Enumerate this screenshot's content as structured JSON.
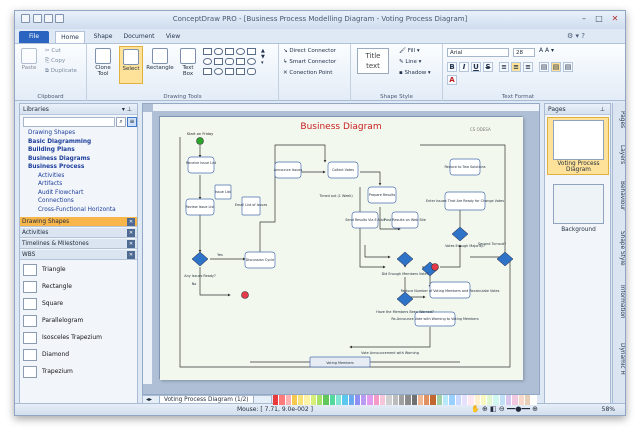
{
  "window": {
    "title": "ConceptDraw PRO - [Business Process Modelling Diagram - Voting Process Diagram]"
  },
  "tabs": [
    "File",
    "Home",
    "Shape",
    "Document",
    "View"
  ],
  "clipboard": {
    "paste": "Paste",
    "cut": "Cut",
    "copy": "Copy",
    "duplicate": "Duplicate",
    "label": "Clipboard"
  },
  "drawing": {
    "clone": "Clone Tool",
    "select": "Select",
    "rectangle": "Rectangle",
    "textbox": "Text Box",
    "direct": "Direct Connector",
    "smart": "Smart Connector",
    "point": "Conection Point",
    "label": "Drawing Tools"
  },
  "shapestyle": {
    "sample": "Title text",
    "fill": "Fill",
    "line": "Line",
    "shadow": "Shadow",
    "label": "Shape Style"
  },
  "textformat": {
    "font": "Arial",
    "size": "28",
    "label": "Text Format",
    "bold": "B",
    "italic": "I",
    "underline": "U",
    "strike": "S"
  },
  "libraries": {
    "header": "Libraries",
    "tree": [
      "Drawing Shapes",
      "Basic Diagramming",
      "Building Plans",
      "Business Diagrams",
      "Business Process",
      "Activities",
      "Artifacts",
      "Audit Flowchart",
      "Connections",
      "Cross-Functional Horizonta"
    ],
    "sections": [
      "Drawing Shapes",
      "Activities",
      "Timelines & Milestones",
      "WBS"
    ],
    "shapes": [
      "Triangle",
      "Rectangle",
      "Square",
      "Parallelogram",
      "Isosceles Trapezium",
      "Diamond",
      "Trapezium"
    ]
  },
  "diagram": {
    "title": "Business Diagram",
    "logo": "CS ODESA",
    "nodes": [
      "Start on Friday",
      "Receive Issue List",
      "Issue List",
      "Email List of Issues",
      "Review Issue List",
      "Any Issues Ready?",
      "Discussion Cycle",
      "Announce Issues",
      "Collect Votes",
      "Timed out (1 Week)",
      "Prepare Results",
      "Send Results Via E-Mail",
      "Post Results on Web Site",
      "Did Enough Members Vote?",
      "Have the Members Been Warned?",
      "Reduce Number of Voting Members and Recalculate Votes",
      "Re-Announce Vote with Warning to Voting Members",
      "Votes Enough Majority?",
      "Second Turnout?",
      "Reduce to Two Solutions",
      "Enter Issues That Are Ready for Change Votes",
      "Voting Members",
      "Vote Announcement with Warning"
    ],
    "labels": {
      "yes": "Yes",
      "no": "No"
    }
  },
  "pagetab": "Voting Process Diagram (1/2)",
  "pages": {
    "header": "Pages",
    "p1": "Voting Process Diagram",
    "p2": "Background"
  },
  "vtabs": [
    "Pages",
    "Layers",
    "Behaviour",
    "Shape Style",
    "Information",
    "Dynamic H"
  ],
  "status": {
    "mouse": "Mouse: [ 7.71, 9.0e-002 ]",
    "zoom": "58%"
  },
  "colors": [
    "#e83a3a",
    "#ff7a7a",
    "#ffb0b0",
    "#f7c850",
    "#f9e27a",
    "#fff3a8",
    "#d7ef7a",
    "#a6e26a",
    "#62c75a",
    "#53d89e",
    "#7fe6d6",
    "#5cc8ef",
    "#6aa8f0",
    "#8d8ff2",
    "#b99cf2",
    "#e19cf0",
    "#f59ac8",
    "#f6c6d8",
    "#d0d0d0",
    "#bcbcbc",
    "#a0a0a0",
    "#8a8a8a",
    "#707070",
    "#f0b890",
    "#e09060",
    "#c06830",
    "#9fd0a8",
    "#b8e8f8",
    "#9ad0ff",
    "#c8d8ff",
    "#e8e0ff",
    "#ffe8f0",
    "#fff0d0",
    "#f8f8c0",
    "#e0f8d0",
    "#d0f8f0",
    "#c0e0f8",
    "#d8c8f0",
    "#f0c8e0",
    "#f8d8c8",
    "#e8d0b8",
    "#ffffff"
  ]
}
